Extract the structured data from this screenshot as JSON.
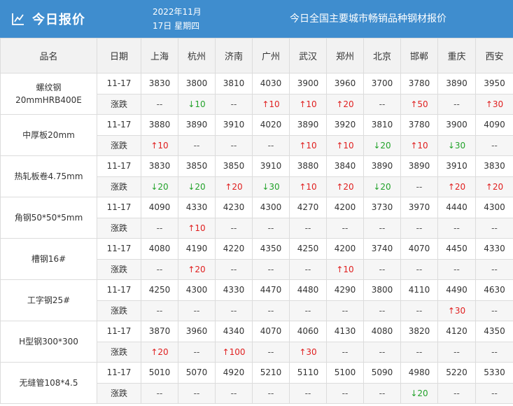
{
  "header": {
    "title": "今日报价",
    "date_line1": "2022年11月",
    "date_line2": "17日 星期四",
    "subtitle": "今日全国主要城市畅销品种钢材报价",
    "icon": "chart-icon"
  },
  "table": {
    "columns": [
      "品名",
      "日期",
      "上海",
      "杭州",
      "济南",
      "广州",
      "武汉",
      "郑州",
      "北京",
      "邯郸",
      "重庆",
      "西安"
    ],
    "change_label": "涨跌",
    "colors": {
      "up": "#e02020",
      "down": "#22a22a",
      "header_bg": "#3f8dce"
    },
    "products": [
      {
        "name": "螺纹钢\n20mmHRB400E",
        "date": "11-17",
        "prices": [
          "3830",
          "3800",
          "3810",
          "4030",
          "3900",
          "3960",
          "3700",
          "3780",
          "3890",
          "3950"
        ],
        "changes": [
          {
            "dir": "flat",
            "text": "--"
          },
          {
            "dir": "down",
            "text": "↓10"
          },
          {
            "dir": "flat",
            "text": "--"
          },
          {
            "dir": "up",
            "text": "↑10"
          },
          {
            "dir": "up",
            "text": "↑10"
          },
          {
            "dir": "up",
            "text": "↑20"
          },
          {
            "dir": "flat",
            "text": "--"
          },
          {
            "dir": "up",
            "text": "↑50"
          },
          {
            "dir": "flat",
            "text": "--"
          },
          {
            "dir": "up",
            "text": "↑30"
          }
        ]
      },
      {
        "name": "中厚板20mm",
        "date": "11-17",
        "prices": [
          "3880",
          "3890",
          "3910",
          "4020",
          "3890",
          "3920",
          "3810",
          "3780",
          "3900",
          "4090"
        ],
        "changes": [
          {
            "dir": "up",
            "text": "↑10"
          },
          {
            "dir": "flat",
            "text": "--"
          },
          {
            "dir": "flat",
            "text": "--"
          },
          {
            "dir": "flat",
            "text": "--"
          },
          {
            "dir": "up",
            "text": "↑10"
          },
          {
            "dir": "up",
            "text": "↑10"
          },
          {
            "dir": "down",
            "text": "↓20"
          },
          {
            "dir": "up",
            "text": "↑10"
          },
          {
            "dir": "down",
            "text": "↓30"
          },
          {
            "dir": "flat",
            "text": "--"
          }
        ]
      },
      {
        "name": "热轧板卷4.75mm",
        "date": "11-17",
        "prices": [
          "3830",
          "3850",
          "3850",
          "3910",
          "3880",
          "3840",
          "3890",
          "3890",
          "3910",
          "3830"
        ],
        "changes": [
          {
            "dir": "down",
            "text": "↓20"
          },
          {
            "dir": "down",
            "text": "↓20"
          },
          {
            "dir": "up",
            "text": "↑20"
          },
          {
            "dir": "down",
            "text": "↓30"
          },
          {
            "dir": "up",
            "text": "↑10"
          },
          {
            "dir": "up",
            "text": "↑20"
          },
          {
            "dir": "down",
            "text": "↓20"
          },
          {
            "dir": "flat",
            "text": "--"
          },
          {
            "dir": "up",
            "text": "↑20"
          },
          {
            "dir": "up",
            "text": "↑20"
          }
        ]
      },
      {
        "name": "角钢50*50*5mm",
        "date": "11-17",
        "prices": [
          "4090",
          "4330",
          "4230",
          "4300",
          "4270",
          "4200",
          "3730",
          "3970",
          "4440",
          "4300"
        ],
        "changes": [
          {
            "dir": "flat",
            "text": "--"
          },
          {
            "dir": "up",
            "text": "↑10"
          },
          {
            "dir": "flat",
            "text": "--"
          },
          {
            "dir": "flat",
            "text": "--"
          },
          {
            "dir": "flat",
            "text": "--"
          },
          {
            "dir": "flat",
            "text": "--"
          },
          {
            "dir": "flat",
            "text": "--"
          },
          {
            "dir": "flat",
            "text": "--"
          },
          {
            "dir": "flat",
            "text": "--"
          },
          {
            "dir": "flat",
            "text": "--"
          }
        ]
      },
      {
        "name": "槽钢16#",
        "date": "11-17",
        "prices": [
          "4080",
          "4190",
          "4220",
          "4350",
          "4250",
          "4200",
          "3740",
          "4070",
          "4450",
          "4330"
        ],
        "changes": [
          {
            "dir": "flat",
            "text": "--"
          },
          {
            "dir": "up",
            "text": "↑20"
          },
          {
            "dir": "flat",
            "text": "--"
          },
          {
            "dir": "flat",
            "text": "--"
          },
          {
            "dir": "flat",
            "text": "--"
          },
          {
            "dir": "up",
            "text": "↑10"
          },
          {
            "dir": "flat",
            "text": "--"
          },
          {
            "dir": "flat",
            "text": "--"
          },
          {
            "dir": "flat",
            "text": "--"
          },
          {
            "dir": "flat",
            "text": "--"
          }
        ]
      },
      {
        "name": "工字钢25#",
        "date": "11-17",
        "prices": [
          "4250",
          "4300",
          "4330",
          "4470",
          "4480",
          "4290",
          "3800",
          "4110",
          "4490",
          "4630"
        ],
        "changes": [
          {
            "dir": "flat",
            "text": "--"
          },
          {
            "dir": "flat",
            "text": "--"
          },
          {
            "dir": "flat",
            "text": "--"
          },
          {
            "dir": "flat",
            "text": "--"
          },
          {
            "dir": "flat",
            "text": "--"
          },
          {
            "dir": "flat",
            "text": "--"
          },
          {
            "dir": "flat",
            "text": "--"
          },
          {
            "dir": "flat",
            "text": "--"
          },
          {
            "dir": "up",
            "text": "↑30"
          },
          {
            "dir": "flat",
            "text": "--"
          }
        ]
      },
      {
        "name": "H型钢300*300",
        "date": "11-17",
        "prices": [
          "3870",
          "3960",
          "4340",
          "4070",
          "4060",
          "4130",
          "4080",
          "3820",
          "4120",
          "4350"
        ],
        "changes": [
          {
            "dir": "up",
            "text": "↑20"
          },
          {
            "dir": "flat",
            "text": "--"
          },
          {
            "dir": "up",
            "text": "↑100"
          },
          {
            "dir": "flat",
            "text": "--"
          },
          {
            "dir": "up",
            "text": "↑30"
          },
          {
            "dir": "flat",
            "text": "--"
          },
          {
            "dir": "flat",
            "text": "--"
          },
          {
            "dir": "flat",
            "text": "--"
          },
          {
            "dir": "flat",
            "text": "--"
          },
          {
            "dir": "flat",
            "text": "--"
          }
        ]
      },
      {
        "name": "无缝管108*4.5",
        "date": "11-17",
        "prices": [
          "5010",
          "5070",
          "4920",
          "5210",
          "5110",
          "5100",
          "5090",
          "4980",
          "5220",
          "5330"
        ],
        "changes": [
          {
            "dir": "flat",
            "text": "--"
          },
          {
            "dir": "flat",
            "text": "--"
          },
          {
            "dir": "flat",
            "text": "--"
          },
          {
            "dir": "flat",
            "text": "--"
          },
          {
            "dir": "flat",
            "text": "--"
          },
          {
            "dir": "flat",
            "text": "--"
          },
          {
            "dir": "flat",
            "text": "--"
          },
          {
            "dir": "down",
            "text": "↓20"
          },
          {
            "dir": "flat",
            "text": "--"
          },
          {
            "dir": "flat",
            "text": "--"
          }
        ]
      }
    ]
  }
}
